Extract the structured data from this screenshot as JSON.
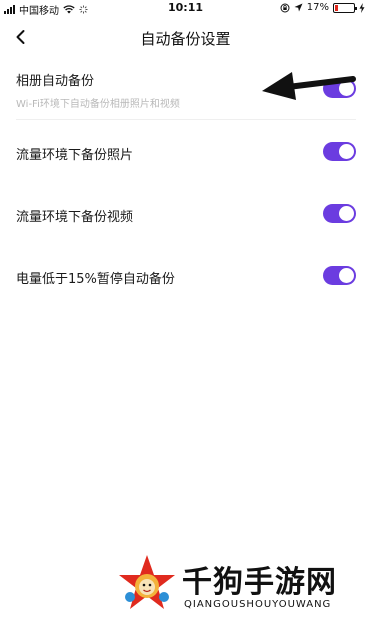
{
  "status_bar": {
    "carrier": "中国移动",
    "time": "10:11",
    "battery": "17%",
    "battery_level": 0.17
  },
  "nav": {
    "title": "自动备份设置"
  },
  "settings": [
    {
      "label": "相册自动备份",
      "sub": "Wi-Fi环境下自动备份相册照片和视频",
      "enabled": true
    },
    {
      "label": "流量环境下备份照片",
      "enabled": true
    },
    {
      "label": "流量环境下备份视频",
      "enabled": true
    },
    {
      "label": "电量低于15%暂停自动备份",
      "enabled": true
    }
  ],
  "colors": {
    "accent": "#6b3ce0",
    "battery_low": "#e0281c"
  },
  "watermark": {
    "cn": "千狗手游网",
    "en": "QIANGOUSHOUYOUWANG"
  }
}
